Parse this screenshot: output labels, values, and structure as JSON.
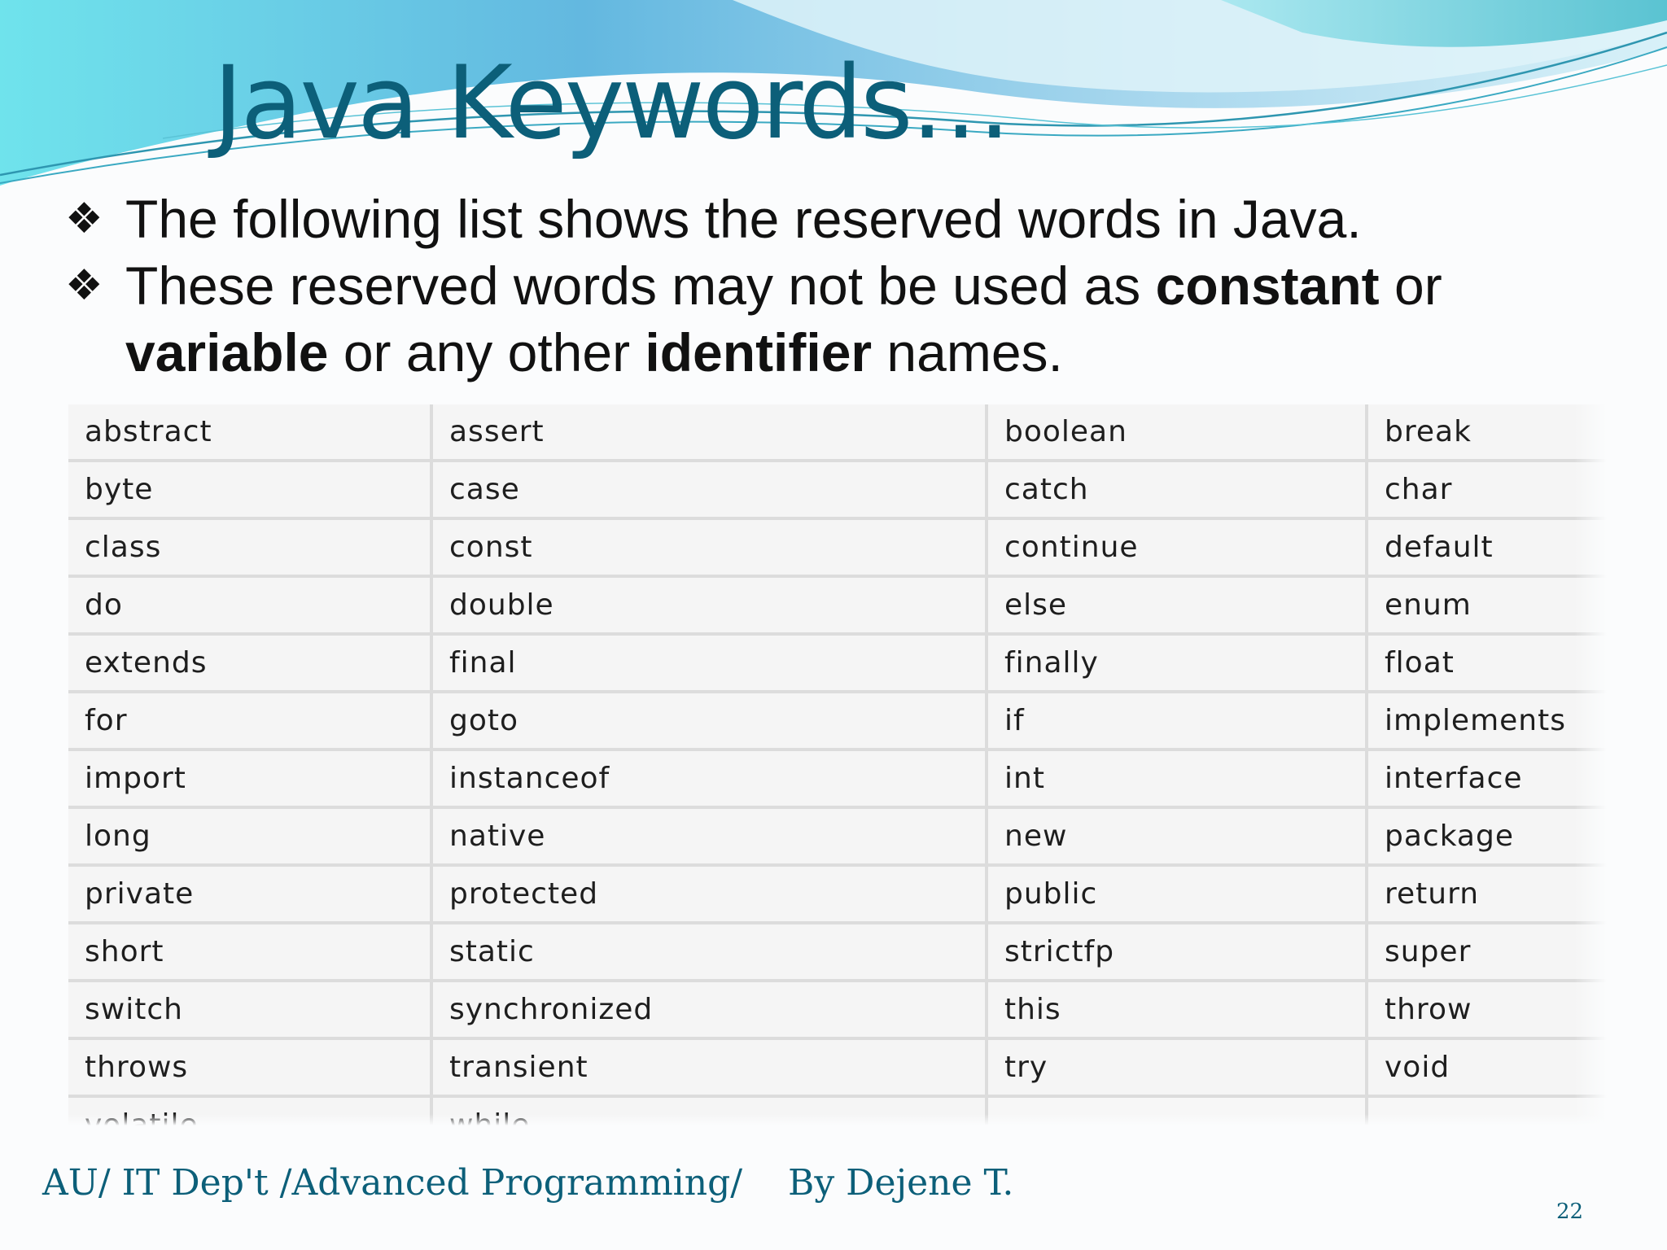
{
  "slide": {
    "title": "Java Keywords…",
    "bullets": [
      {
        "marker": "❖",
        "parts": [
          {
            "text": "The following list shows the reserved words in Java.",
            "bold": false
          }
        ]
      },
      {
        "marker": "❖",
        "parts": [
          {
            "text": "These reserved words may not be used as ",
            "bold": false
          },
          {
            "text": "constant",
            "bold": true
          },
          {
            "text": " or ",
            "bold": false
          },
          {
            "text": "variable",
            "bold": true
          },
          {
            "text": " or any other ",
            "bold": false
          },
          {
            "text": "identifier",
            "bold": true
          },
          {
            "text": " names.",
            "bold": false
          }
        ]
      }
    ],
    "keywords_table": {
      "rows": [
        [
          "abstract",
          "assert",
          "boolean",
          "break"
        ],
        [
          "byte",
          "case",
          "catch",
          "char"
        ],
        [
          "class",
          "const",
          "continue",
          "default"
        ],
        [
          "do",
          "double",
          "else",
          "enum"
        ],
        [
          "extends",
          "final",
          "finally",
          "float"
        ],
        [
          "for",
          "goto",
          "if",
          "implements"
        ],
        [
          "import",
          "instanceof",
          "int",
          "interface"
        ],
        [
          "long",
          "native",
          "new",
          "package"
        ],
        [
          "private",
          "protected",
          "public",
          "return"
        ],
        [
          "short",
          "static",
          "strictfp",
          "super"
        ],
        [
          "switch",
          "synchronized",
          "this",
          "throw"
        ],
        [
          "throws",
          "transient",
          "try",
          "void"
        ],
        [
          "volatile",
          "while",
          "",
          ""
        ]
      ]
    },
    "footer": {
      "course": "AU/ IT Dep't /Advanced Programming/",
      "author": "By Dejene T.",
      "page_number": "22"
    },
    "colors": {
      "title": "#0c5f79",
      "footer": "#0c5f79",
      "banner_light": "#7fdde6",
      "banner_dark": "#3aa5c6",
      "body_text": "#111111"
    }
  }
}
